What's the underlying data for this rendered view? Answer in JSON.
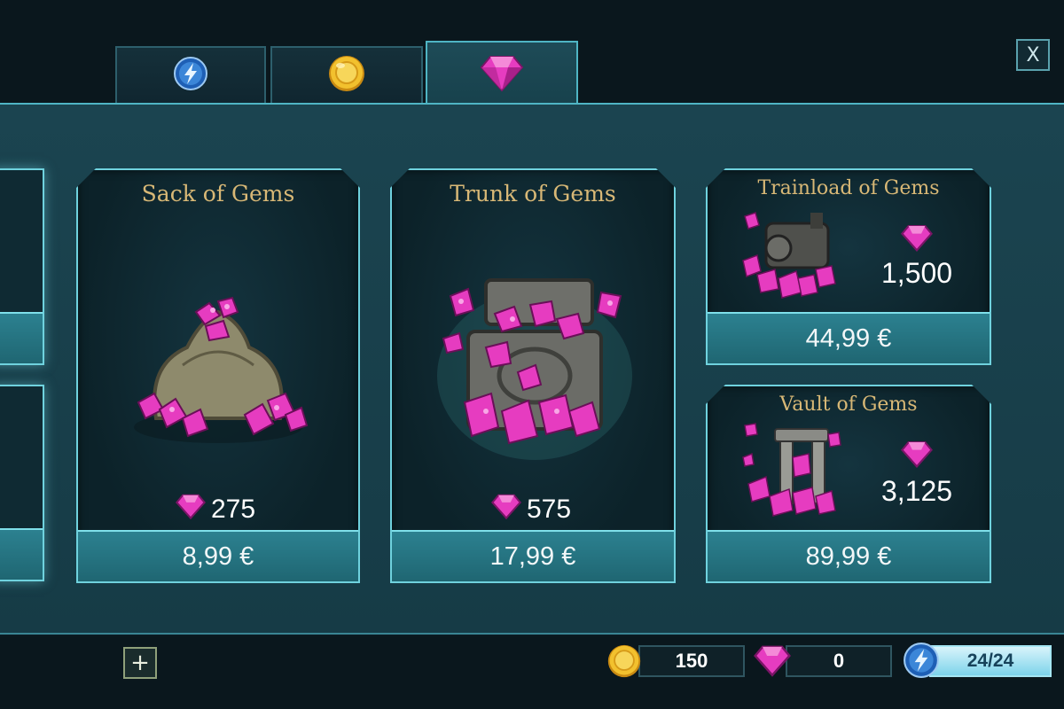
{
  "header": {
    "tabs": [
      {
        "icon": "energy-icon",
        "active": false
      },
      {
        "icon": "coin-icon",
        "active": false
      },
      {
        "icon": "gem-icon",
        "active": true
      }
    ],
    "close_label": "X"
  },
  "offers": [
    {
      "title": "Sack of Gems",
      "gems": "275",
      "price": "8,99 €",
      "image": "gem-sack-icon"
    },
    {
      "title": "Trunk of Gems",
      "gems": "575",
      "price": "17,99 €",
      "image": "gem-trunk-icon"
    },
    {
      "title": "Trainload of Gems",
      "gems": "1,500",
      "price": "44,99 €",
      "image": "gem-train-icon"
    },
    {
      "title": "Vault of Gems",
      "gems": "3,125",
      "price": "89,99 €",
      "image": "gem-vault-icon"
    }
  ],
  "footer": {
    "plus_label": "+",
    "coins": "150",
    "gems": "0",
    "energy": "24/24",
    "energy_fill": 1.0
  },
  "colors": {
    "accent": "#6fd2de",
    "title_gold": "#d8b876",
    "gem_pink": "#e63cc0",
    "coin_gold": "#f2c12e"
  }
}
